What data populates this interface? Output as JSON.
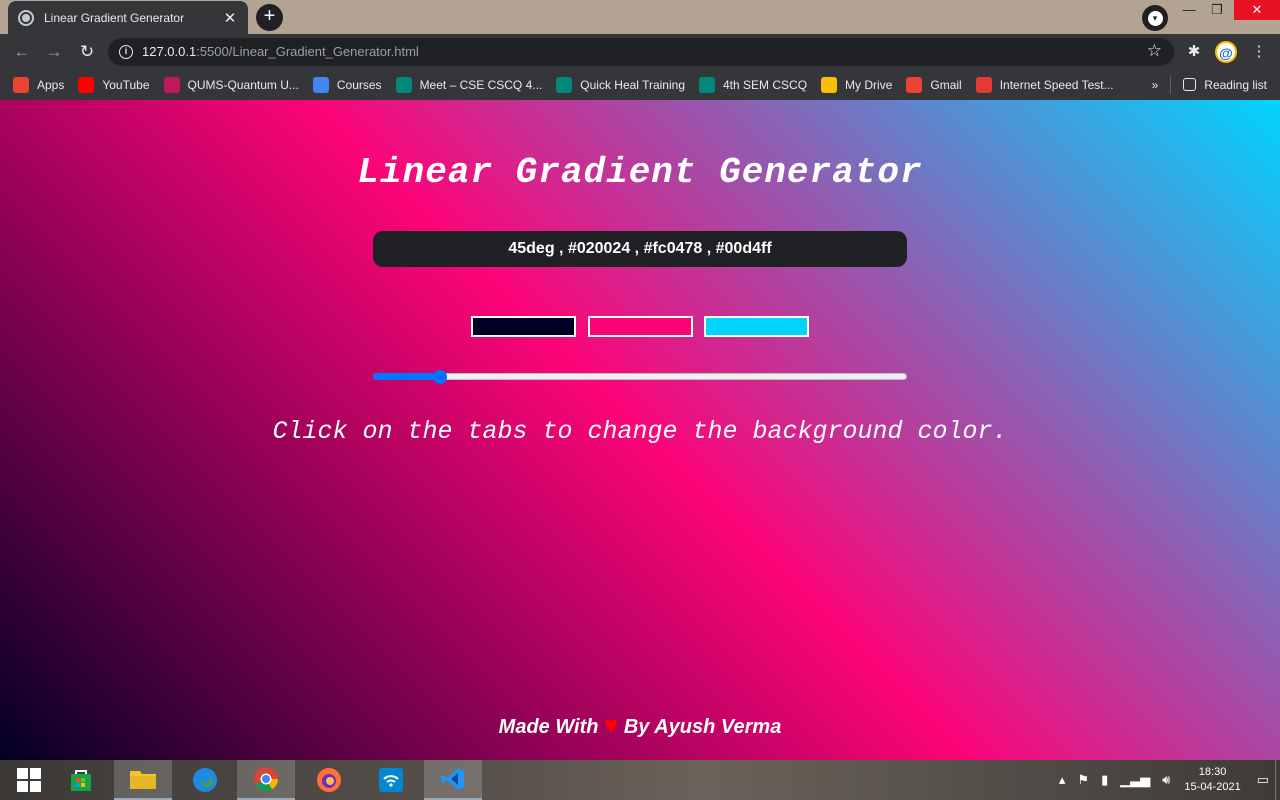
{
  "browser": {
    "tab_title": "Linear Gradient Generator",
    "tab_close": "✕",
    "new_tab": "+",
    "url_host": "127.0.0.1",
    "url_rest": ":5500/Linear_Gradient_Generator.html",
    "window_controls": {
      "minimize": "—",
      "restore": "❐",
      "close": "✕"
    }
  },
  "bookmarks": [
    {
      "label": "Apps",
      "color": "#ea4335"
    },
    {
      "label": "YouTube",
      "color": "#ff0000"
    },
    {
      "label": "QUMS-Quantum U...",
      "color": "#c2185b"
    },
    {
      "label": "Courses",
      "color": "#4285f4"
    },
    {
      "label": "Meet – CSE CSCQ 4...",
      "color": "#00897b"
    },
    {
      "label": "Quick Heal Training",
      "color": "#00897b"
    },
    {
      "label": "4th SEM CSCQ",
      "color": "#00897b"
    },
    {
      "label": "My Drive",
      "color": "#fbbc04"
    },
    {
      "label": "Gmail",
      "color": "#ea4335"
    },
    {
      "label": "Internet Speed Test...",
      "color": "#e53935"
    }
  ],
  "bookmarks_overflow": "»",
  "reading_list": "Reading list",
  "page": {
    "title": "Linear Gradient Generator",
    "css_readout": "45deg , #020024 , #fc0478 , #00d4ff",
    "colors": [
      "#020024",
      "#fc0478",
      "#00d4ff"
    ],
    "angle_deg": 45,
    "angle_max": 360,
    "hint": "Click on the tabs to change the background color.",
    "footer_before": "Made With ",
    "footer_heart": "♥",
    "footer_after": " By Ayush Verma"
  },
  "taskbar": {
    "time": "18:30",
    "date": "15-04-2021"
  }
}
